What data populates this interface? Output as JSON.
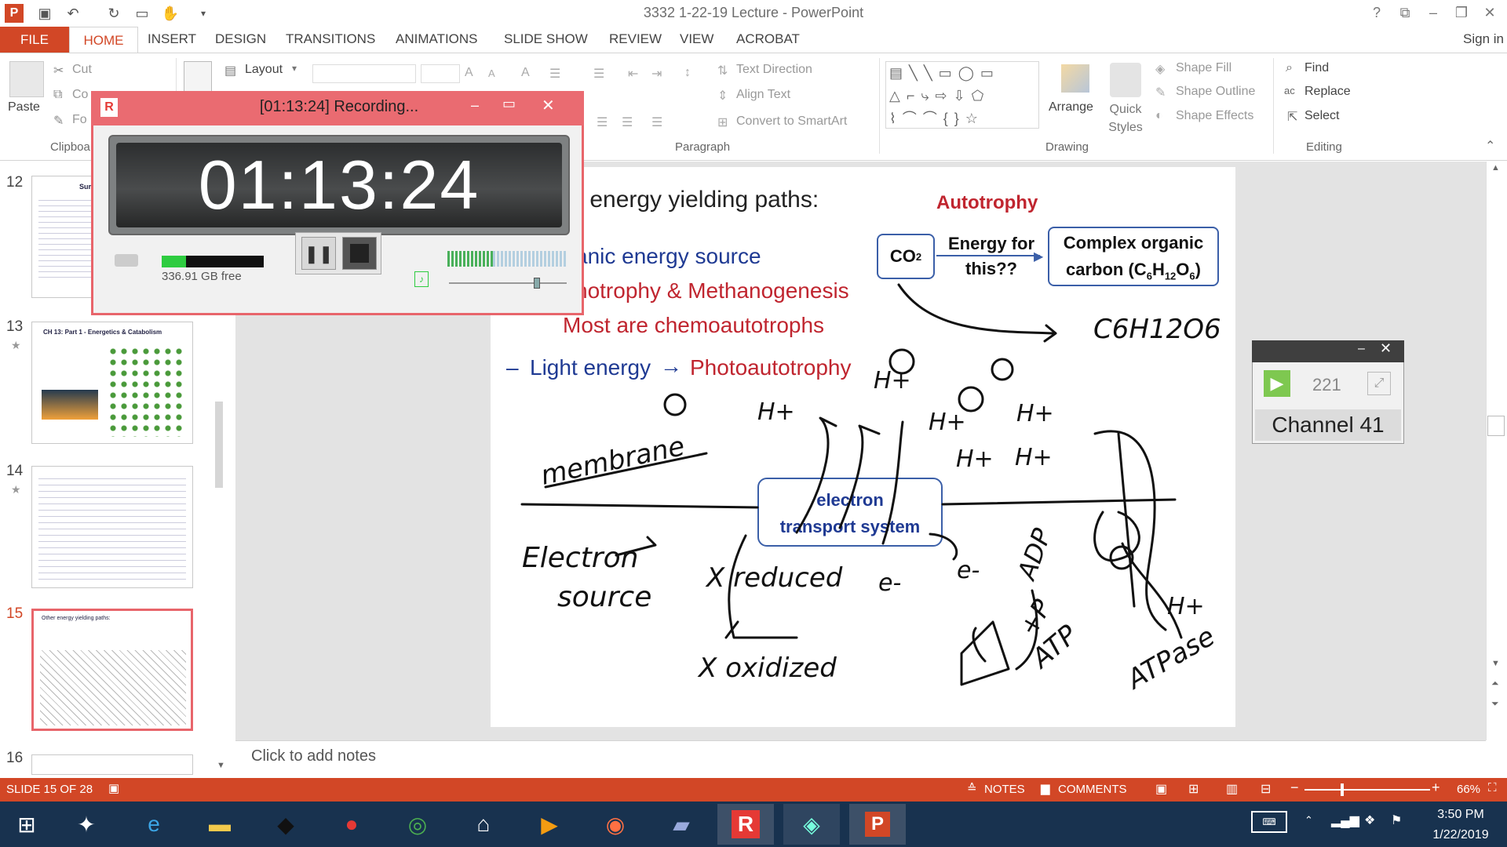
{
  "window": {
    "title": "3332 1-22-19 Lecture - PowerPoint",
    "sign_in": "Sign in"
  },
  "tabs": {
    "file": "FILE",
    "home": "HOME",
    "insert": "INSERT",
    "design": "DESIGN",
    "transitions": "TRANSITIONS",
    "animations": "ANIMATIONS",
    "slide_show": "SLIDE SHOW",
    "review": "REVIEW",
    "view": "VIEW",
    "acrobat": "ACROBAT"
  },
  "ribbon": {
    "paste": "Paste",
    "cut": "Cut",
    "copy": "Co",
    "format_painter": "Fo",
    "clipboard_group": "Clipboa",
    "layout": "Layout",
    "text_direction": "Text Direction",
    "align_text": "Align Text",
    "convert_smartart": "Convert to SmartArt",
    "paragraph_group": "Paragraph",
    "arrange": "Arrange",
    "quick_styles": "Quick Styles",
    "shape_fill": "Shape Fill",
    "shape_outline": "Shape Outline",
    "shape_effects": "Shape Effects",
    "drawing_group": "Drawing",
    "find": "Find",
    "replace": "Replace",
    "select": "Select",
    "editing_group": "Editing"
  },
  "thumbnails": [
    {
      "num": "12",
      "title": "Sum"
    },
    {
      "num": "13",
      "title": "CH 13: Part 1 - Energetics & Catabolism"
    },
    {
      "num": "14",
      "title": ""
    },
    {
      "num": "15",
      "title": "Other energy yielding paths:"
    },
    {
      "num": "16",
      "title": ""
    }
  ],
  "slide": {
    "heading": "r energy yielding paths:",
    "line1": "anic energy source",
    "line2": "hotrophy & Methanogenesis",
    "line3": "Most are chemoautotrophs",
    "line4_dash": "–",
    "line4_a": "Light energy",
    "line4_arrow": "→",
    "line4_b": "Photoautotrophy",
    "autotrophy": "Autotrophy",
    "co2": "CO",
    "co2_sub": "2",
    "energy_for_1": "Energy for",
    "energy_for_2": "this??",
    "complex_1": "Complex organic",
    "complex_2a": "carbon (C",
    "complex_sub6": "6",
    "complex_h": "H",
    "complex_sub12": "12",
    "complex_o": "O",
    "complex_2b": ")",
    "ets_1": "electron",
    "ets_2": "transport system",
    "ink": {
      "membrane": "membrane",
      "electron_source_1": "Electron",
      "electron_source_2": "source",
      "x_reduced": "X reduced",
      "x_oxidized": "X oxidized",
      "c6h12o6": "C6H12O6",
      "adp": "ADP",
      "plus_p": "+P",
      "atp": "ATP",
      "atpase": "ATPase",
      "e_minus": "e-",
      "h_plus": "H+"
    }
  },
  "notes": {
    "placeholder": "Click to add notes"
  },
  "status": {
    "slide": "SLIDE 15 OF 28",
    "notes": "NOTES",
    "comments": "COMMENTS",
    "zoom": "66%",
    "zoom_minus": "−",
    "zoom_plus": "+"
  },
  "recorder": {
    "title": "[01:13:24] Recording...",
    "time": "01:13:24",
    "disk_free": "336.91 GB free"
  },
  "channel_widget": {
    "count": "221",
    "channel": "Channel 41"
  },
  "taskbar": {
    "time": "3:50 PM",
    "date": "1/22/2019"
  }
}
